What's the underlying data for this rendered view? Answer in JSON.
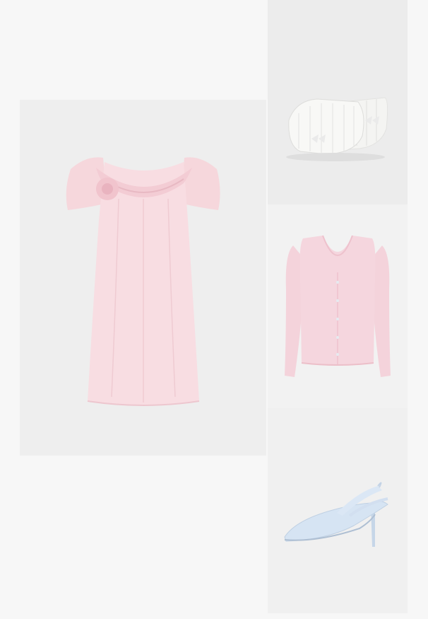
{
  "outfit": {
    "items": [
      {
        "product": "dress",
        "icon": "pink-ruffle-dress-image",
        "color": "#f8dde2"
      },
      {
        "product": "cosmetic-bags",
        "icon": "white-quilted-bags-image",
        "color": "#f6f6f4"
      },
      {
        "product": "cardigan",
        "icon": "pink-knit-cardigan-image",
        "color": "#f5d6de"
      },
      {
        "product": "heels",
        "icon": "light-blue-slingback-heels-image",
        "color": "#cfdff0"
      }
    ],
    "background_color": "#f7f7f7",
    "tile_color": "#eeeeee"
  }
}
